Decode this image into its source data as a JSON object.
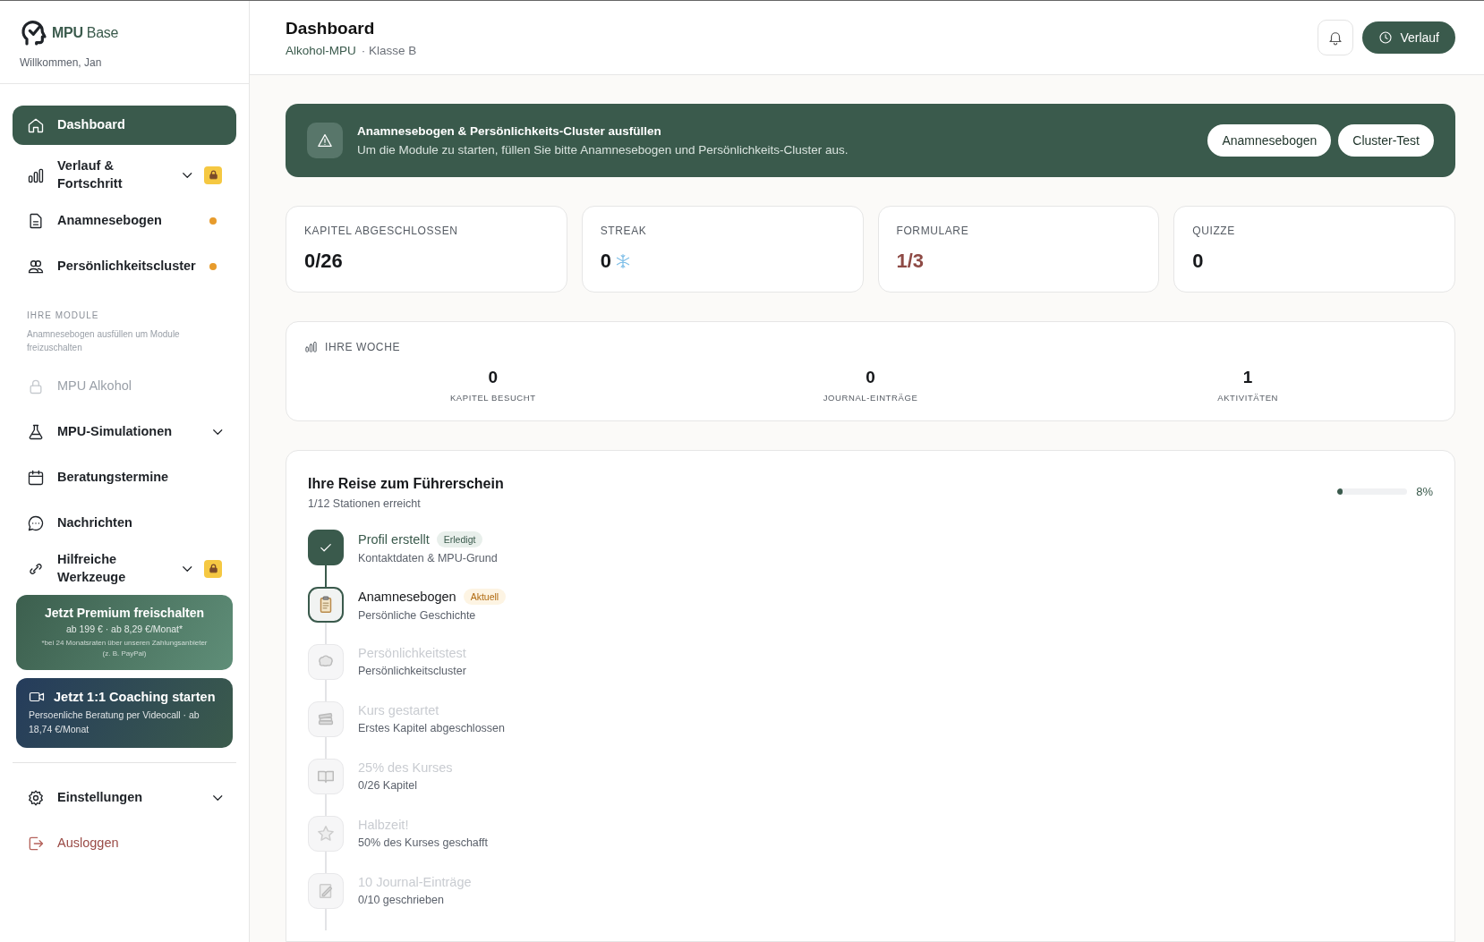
{
  "sidebar": {
    "logo": "**MPU** Base",
    "welcome": "Willkommen, Jan",
    "nav": [
      {
        "label": "Dashboard",
        "selected": true,
        "expandable": false,
        "locked": false,
        "pending": false,
        "disabled": false
      },
      {
        "label": "Verlauf & Fortschritt",
        "selected": false,
        "expandable": true,
        "locked": true,
        "pending": false,
        "disabled": false
      },
      {
        "label": "Anamnesebogen",
        "selected": false,
        "expandable": false,
        "locked": false,
        "pending": true,
        "disabled": false
      },
      {
        "label": "Persönlichkeitscluster",
        "selected": false,
        "expandable": false,
        "locked": false,
        "pending": true,
        "disabled": false
      }
    ],
    "modules": {
      "title": "IHRE MODULE",
      "hint": "Anamnesebogen ausfüllen um Module freizuschalten",
      "items": [
        {
          "label": "MPU Alkohol",
          "selected": false,
          "expandable": false,
          "locked": false,
          "pending": false,
          "disabled": true
        },
        {
          "label": "MPU-Simulationen",
          "selected": false,
          "expandable": true,
          "locked": false,
          "pending": false,
          "disabled": false
        },
        {
          "label": "Beratungstermine",
          "selected": false,
          "expandable": false,
          "locked": false,
          "pending": false,
          "disabled": false
        },
        {
          "label": "Nachrichten",
          "selected": false,
          "expandable": false,
          "locked": false,
          "pending": false,
          "disabled": false
        },
        {
          "label": "Hilfreiche Werkzeuge",
          "selected": false,
          "expandable": true,
          "locked": true,
          "pending": false,
          "disabled": false
        }
      ]
    },
    "premium": {
      "title": "Jetzt Premium freischalten",
      "price": "ab 199 € · ab 8,29 €/Monat*",
      "footnote": "*bei 24 Monatsraten über unseren Zahlungsanbieter (z. B. PayPal)"
    },
    "coaching": {
      "title": "Jetzt 1:1 Coaching starten",
      "text": "Persoenliche Beratung per Videocall · ab 18,74 €/Monat"
    },
    "footer_nav": [
      {
        "label": "Einstellungen",
        "kind": "settings",
        "expandable": true
      },
      {
        "label": "Ausloggen",
        "kind": "logout",
        "expandable": false
      }
    ]
  },
  "header": {
    "title": "Dashboard",
    "program": "Alkohol-MPU",
    "license_class": "· Klasse B",
    "button": "Verlauf"
  },
  "banner": {
    "title": "Anamnesebogen & Persönlichkeits-Cluster ausfüllen",
    "text": "Um die Module zu starten, füllen Sie bitte Anamnesebogen und Persönlichkeits-Cluster aus.",
    "buttons": [
      "Anamnesebogen",
      "Cluster-Test"
    ]
  },
  "stats": [
    {
      "label": "KAPITEL ABGESCHLOSSEN",
      "value": "0/26",
      "kind": "plain"
    },
    {
      "label": "STREAK",
      "value": "0",
      "kind": "streak"
    },
    {
      "label": "FORMULARE",
      "value": "1/3",
      "kind": "alert"
    },
    {
      "label": "QUIZZE",
      "value": "0",
      "kind": "plain"
    }
  ],
  "week": {
    "title": "IHRE WOCHE",
    "items": [
      {
        "value": "0",
        "label": "KAPITEL BESUCHT"
      },
      {
        "value": "0",
        "label": "JOURNAL-EINTRÄGE"
      },
      {
        "value": "1",
        "label": "AKTIVITÄTEN"
      }
    ]
  },
  "journey": {
    "title": "Ihre Reise zum Führerschein",
    "subtitle": "1/12 Stationen erreicht",
    "level": 0.08,
    "reading": "8%",
    "stations": [
      {
        "title": "Profil erstellt",
        "subtitle": "Kontaktdaten & MPU-Grund",
        "kind": "done",
        "badge": "Erledigt"
      },
      {
        "title": "Anamnesebogen",
        "subtitle": "Persönliche Geschichte",
        "kind": "current",
        "badge": "Aktuell"
      },
      {
        "title": "Persönlichkeitstest",
        "subtitle": "Persönlichkeitscluster",
        "kind": "locked"
      },
      {
        "title": "Kurs gestartet",
        "subtitle": "Erstes Kapitel abgeschlossen",
        "kind": "locked"
      },
      {
        "title": "25% des Kurses",
        "subtitle": "0/26 Kapitel",
        "kind": "locked"
      },
      {
        "title": "Halbzeit!",
        "subtitle": "50% des Kurses geschafft",
        "kind": "locked"
      },
      {
        "title": "10 Journal-Einträge",
        "subtitle": "0/10 geschrieben",
        "kind": "locked"
      }
    ]
  }
}
